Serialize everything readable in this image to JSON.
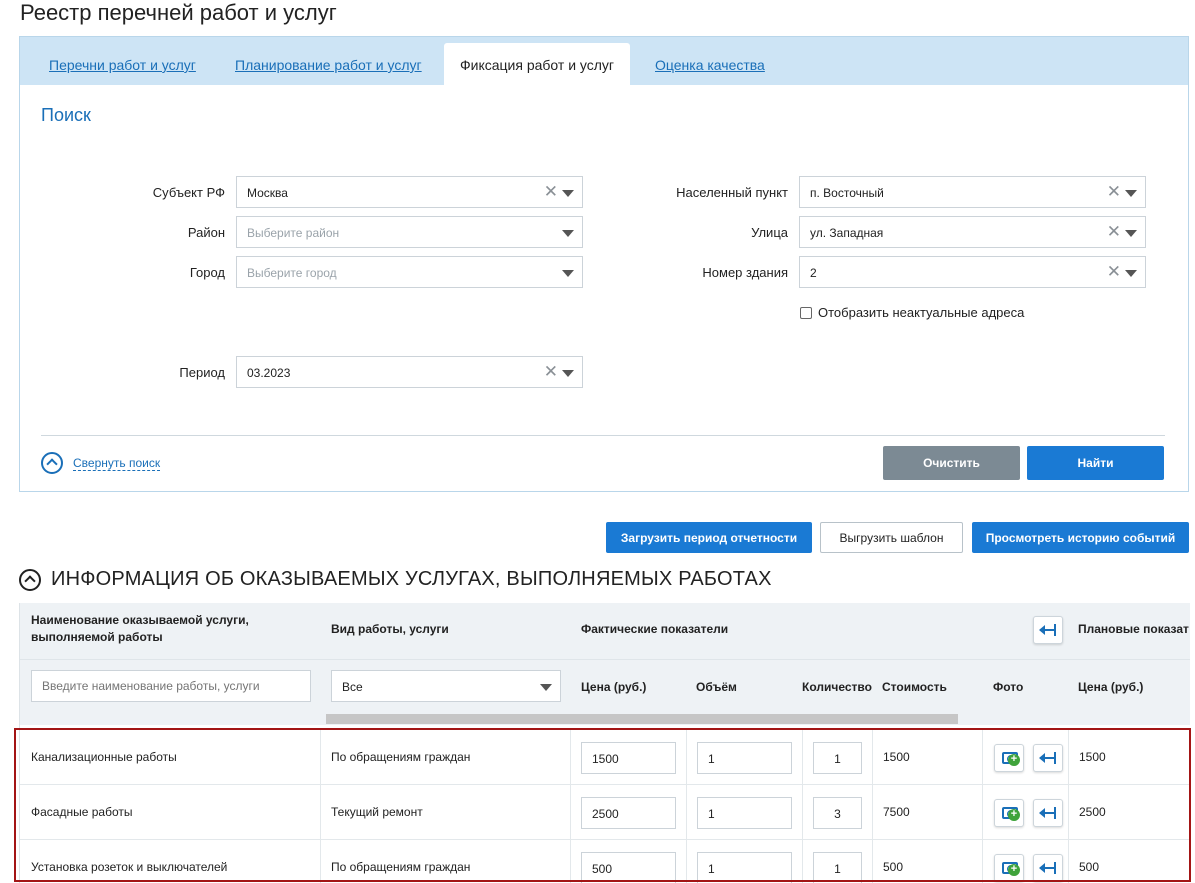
{
  "page": {
    "title": "Реестр перечней работ и услуг"
  },
  "tabs": [
    {
      "label": "Перечни работ и услуг",
      "active": false
    },
    {
      "label": "Планирование работ и услуг",
      "active": false
    },
    {
      "label": "Фиксация работ и услуг",
      "active": true
    },
    {
      "label": "Оценка качества",
      "active": false
    }
  ],
  "search": {
    "title": "Поиск",
    "subject": {
      "label": "Субъект РФ",
      "value": "Москва"
    },
    "district": {
      "label": "Район",
      "placeholder": "Выберите район"
    },
    "city": {
      "label": "Город",
      "placeholder": "Выберите город"
    },
    "settlement": {
      "label": "Населенный пункт",
      "value": "п. Восточный"
    },
    "street": {
      "label": "Улица",
      "value": "ул. Западная"
    },
    "building": {
      "label": "Номер здания",
      "value": "2"
    },
    "show_inactive": {
      "label": "Отобразить неактуальные адреса",
      "checked": false
    },
    "period": {
      "label": "Период",
      "value": "03.2023"
    },
    "collapse_label": "Свернуть поиск",
    "clear_button": "Очистить",
    "find_button": "Найти"
  },
  "actions": {
    "upload_period": "Загрузить период отчетности",
    "export_template": "Выгрузить шаблон",
    "view_history": "Просмотреть историю событий"
  },
  "services": {
    "title": "ИНФОРМАЦИЯ ОБ ОКАЗЫВАЕМЫХ УСЛУГАХ, ВЫПОЛНЯЕМЫХ РАБОТАХ",
    "headers": {
      "name_line1": "Наименование оказываемой услуги,",
      "name_line2": "выполняемой работы",
      "type": "Вид работы, услуги",
      "actual": "Фактические показатели",
      "planned": "Плановые показат",
      "price": "Цена (руб.)",
      "volume": "Объём",
      "quantity": "Количество",
      "cost": "Стоимость",
      "photo": "Фото",
      "planned_price": "Цена (руб.)"
    },
    "filter": {
      "name_placeholder": "Введите наименование работы, услуги",
      "type_value": "Все"
    },
    "rows": [
      {
        "name": "Канализационные работы",
        "type": "По обращениям граждан",
        "price": "1500",
        "volume": "1",
        "quantity": "1",
        "cost": "1500",
        "planned_price": "1500"
      },
      {
        "name": "Фасадные работы",
        "type": "Текущий ремонт",
        "price": "2500",
        "volume": "1",
        "quantity": "3",
        "cost": "7500",
        "planned_price": "2500"
      },
      {
        "name": "Установка розеток и выключателей",
        "type": "По обращениям граждан",
        "price": "500",
        "volume": "1",
        "quantity": "1",
        "cost": "500",
        "planned_price": "500"
      }
    ]
  },
  "colors": {
    "accent": "#1a7ad4",
    "tabbar": "#cde4f5",
    "highlight": "#a31515",
    "clear_button": "#7c8a94"
  }
}
